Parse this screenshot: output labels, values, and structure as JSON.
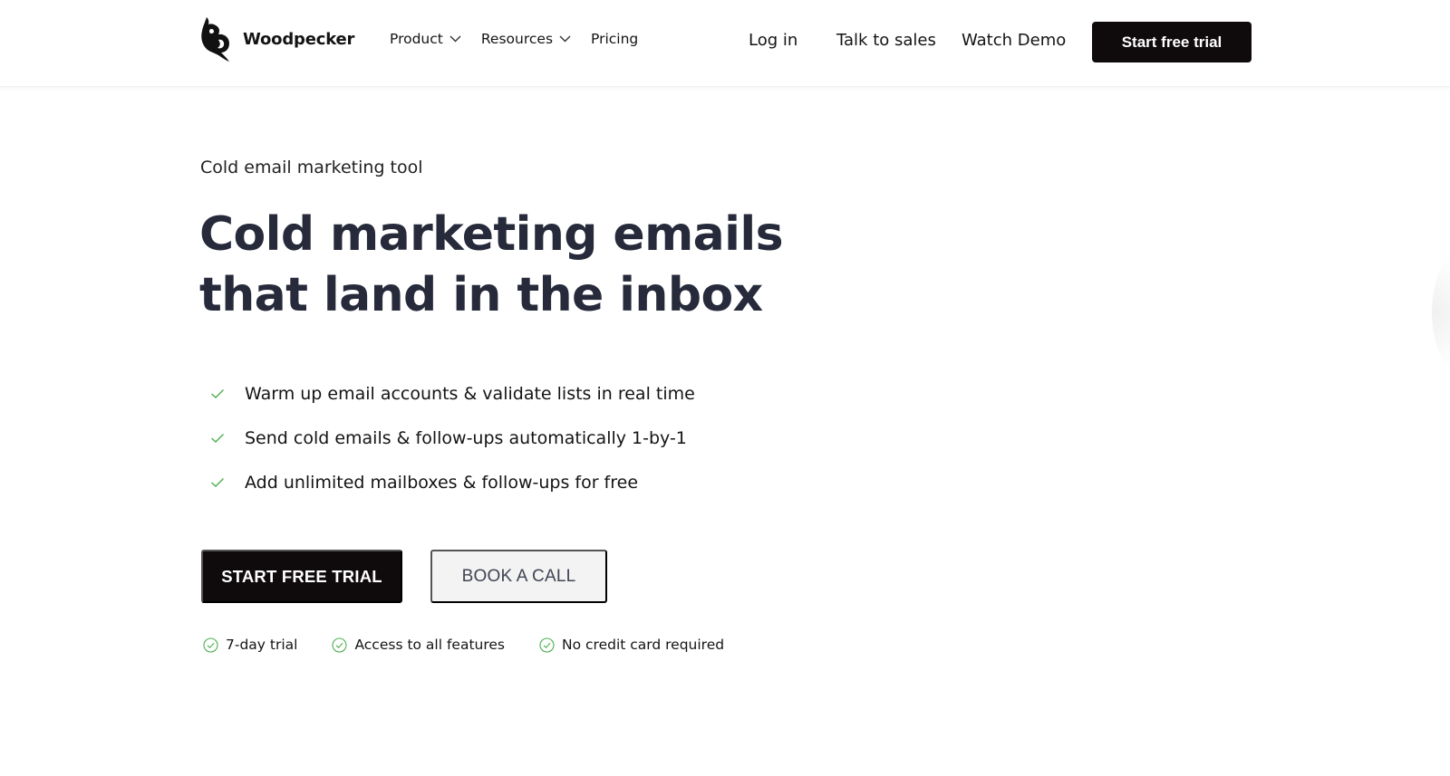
{
  "header": {
    "brand": "Woodpecker",
    "nav": [
      {
        "label": "Product",
        "has_dropdown": true
      },
      {
        "label": "Resources",
        "has_dropdown": true
      },
      {
        "label": "Pricing",
        "has_dropdown": false
      }
    ],
    "login": "Log in",
    "talk_to_sales": "Talk to sales",
    "watch_demo": "Watch Demo",
    "cta": "Start free trial"
  },
  "hero": {
    "eyebrow": "Cold email marketing tool",
    "headline_line1": "Cold marketing emails",
    "headline_line2": "that land in the inbox",
    "features": [
      "Warm up email accounts & validate lists in real time",
      "Send cold emails & follow-ups automatically 1-by-1",
      "Add unlimited mailboxes & follow-ups for free"
    ],
    "primary_button": "START FREE TRIAL",
    "secondary_button": "BOOK A CALL",
    "perks": [
      "7-day trial",
      "Access to all features",
      "No credit card required"
    ]
  },
  "icons": {
    "logo": "woodpecker-logo-icon",
    "dropdown": "chevron-down-icon",
    "feature_check": "check-icon",
    "perk_check": "check-circle-icon"
  },
  "colors": {
    "brand_dark": "#0f0a0b",
    "headline": "#262a3a",
    "check_green": "#4caf50",
    "secondary_button_bg": "#f3f3f3"
  }
}
